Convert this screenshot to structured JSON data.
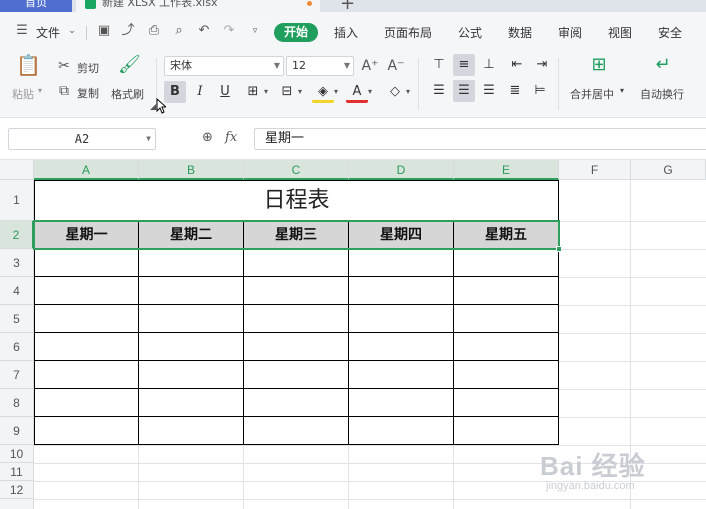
{
  "tabs": {
    "home": "首页",
    "document": "新建 XLSX 工作表.xlsx",
    "new_tab": "+"
  },
  "menu": {
    "file": "文件",
    "items": [
      "开始",
      "插入",
      "页面布局",
      "公式",
      "数据",
      "审阅",
      "视图",
      "安全"
    ]
  },
  "ribbon": {
    "paste": "粘贴",
    "cut": "剪切",
    "copy": "复制",
    "format_painter": "格式刷",
    "font_name": "宋体",
    "font_size": "12",
    "merge_center": "合并居中",
    "wrap_text": "自动换行",
    "increase_font": "A⁺",
    "decrease_font": "A⁻"
  },
  "formula_bar": {
    "name_box": "A2",
    "fx": "fx",
    "value": "星期一"
  },
  "columns": [
    "A",
    "B",
    "C",
    "D",
    "E",
    "F",
    "G"
  ],
  "rows": [
    "1",
    "2",
    "3",
    "4",
    "5",
    "6",
    "7",
    "8",
    "9",
    "10",
    "11",
    "12"
  ],
  "sheet": {
    "title": "日程表",
    "headers": [
      "星期一",
      "星期二",
      "星期三",
      "星期四",
      "星期五"
    ]
  },
  "watermark": {
    "brand": "Bai 经验",
    "url": "jingyan.baidu.com"
  },
  "colors": {
    "accent_green": "#1f9e5d",
    "selection_green": "#2f9f5f",
    "header_gray": "#d6d6d6"
  }
}
